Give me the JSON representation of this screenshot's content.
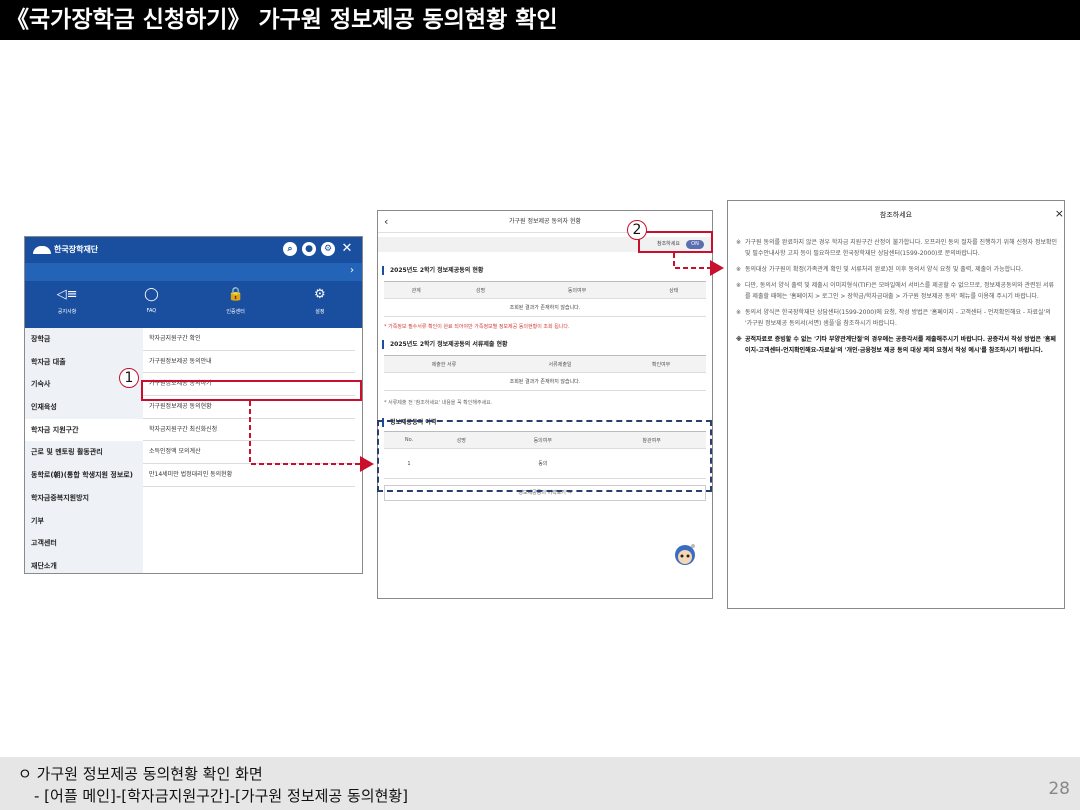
{
  "banner": {
    "title": "《국가장학금 신청하기》 가구원 정보제공 동의현황 확인"
  },
  "footer": {
    "line1": "ㅇ 가구원 정보제공 동의현황 확인 화면",
    "line2": "- [어플 메인]-[학자금지원구간]-[가구원 정보제공 동의현황]",
    "page": "28"
  },
  "callouts": {
    "one": "1",
    "two": "2"
  },
  "app": {
    "logo": "한국장학재단",
    "top_icons": [
      "search-icon",
      "user-icon",
      "settings-icon",
      "close-icon"
    ],
    "quick": [
      {
        "icon": "megaphone-icon",
        "glyph": "◁≡",
        "label": "공지사항"
      },
      {
        "icon": "chat-icon",
        "glyph": "◯",
        "label": "FAQ"
      },
      {
        "icon": "lock-icon",
        "glyph": "🔒",
        "label": "인증센터"
      },
      {
        "icon": "gear-icon",
        "glyph": "⚙",
        "label": "설정"
      }
    ],
    "side_menu": [
      "장학금",
      "학자금 대출",
      "기숙사",
      "인재육성",
      "학자금 지원구간",
      "근로 및 멘토링 활동관리",
      "동학로(朝)(통합 학생지원 정보로)",
      "학자금중복지원방지",
      "기부",
      "고객센터",
      "재단소개"
    ],
    "active_index": 4,
    "sub_menu": [
      "학자금지원구간 확인",
      "가구원정보제공 동의안내",
      "가구원정보제공 동의하기",
      "가구원정보제공 동의현황",
      "학자금지원구간 최신화신청",
      "소득인정액 모의계산",
      "만14세미만 법정대리인 동의현황"
    ]
  },
  "consent": {
    "header": "가구원 정보제공 동의자 현황",
    "reference_label": "참조하세요",
    "toggle": "ON",
    "section1": "2025년도 2학기 정보제공동의 현황",
    "table1_cols": [
      "관계",
      "성명",
      "동의여부",
      "상태"
    ],
    "table1_empty": "조회된 결과가 존재하지 않습니다.",
    "red_note": "* 가족정보 필수서류 확인이 완료 되어야만 가족정보별 정보제공 동의현황이 조회 됩니다.",
    "section2": "2025년도 2학기 정보제공동의 서류제출 현황",
    "table2_cols": [
      "제출한 서류",
      "서류제출일",
      "확인여부"
    ],
    "table2_empty": "조회된 결과가 존재하지 않습니다.",
    "gray_note": "* 서류제출 전 '참조하세요' 내용을 꼭 확인해주세요.",
    "section3": "정보제공동의 이력",
    "table3_cols": [
      "No.",
      "성명",
      "동의여부",
      "참관여부"
    ],
    "table3_row": [
      "1",
      "",
      "동의",
      ""
    ],
    "more": "정보제공동의 이력보기 →"
  },
  "notice": {
    "title": "참조하세요",
    "close": "×",
    "items": [
      {
        "mark": "※",
        "text": "가구원 동의를 완료하지 않은 경우 학자금 지원구간 산정이 불가합니다. 오프라인 동의 절차를 진행하기 위해 신청자 정보확인 및 필수안내사항 고지 등이 필요하므로 한국장학재단 상담센터(1599-2000)로 문의바랍니다.",
        "bold": false
      },
      {
        "mark": "※",
        "text": "동의대상 가구원이 확정(가족관계 확인 및 서류처리 완료)된 이후 동의서 양식 요청 및 출력, 제출이 가능합니다.",
        "bold": false
      },
      {
        "mark": "※",
        "text": "다만, 동의서 양식 출력 및 제출시 이미지형식(TIF)은 모바일에서 서비스를 제공할 수 없으므로, 정보제공동의와 관련된 서류를 제출할 때에는 '홈페이지 > 로그인 > 장학금/학자금대출 > 가구원 정보제공 동의' 메뉴를 이용해 주시기 바랍니다.",
        "bold": false
      },
      {
        "mark": "※",
        "text": "동의서 양식은 한국장학재단 상담센터(1599-2000)에 요청, 작성 방법은 '홈페이지 - 고객센터 - 언저확인해요 - 자료실'의 '가구원 정보제공 동의서(서면) 샘플'을 참조하시기 바랍니다.",
        "bold": false
      },
      {
        "mark": "※",
        "text": "공적자료로 증빙할 수 없는 '기타 부양관계단절'의 경우에는 공증각서를 제출해주시기 바랍니다. 공증각서 작성 방법은 '홈페이지-고객센터-언지확인해요-자료실'의 '개인·금융정보 제공 동의 대상 제외 요청서 작성 예시'를 참조하시기 바랍니다.",
        "bold": true
      }
    ]
  },
  "colors": {
    "accent_red": "#c8102e",
    "brand_blue": "#1a4fa0",
    "dash_navy": "#2a3d6e"
  }
}
